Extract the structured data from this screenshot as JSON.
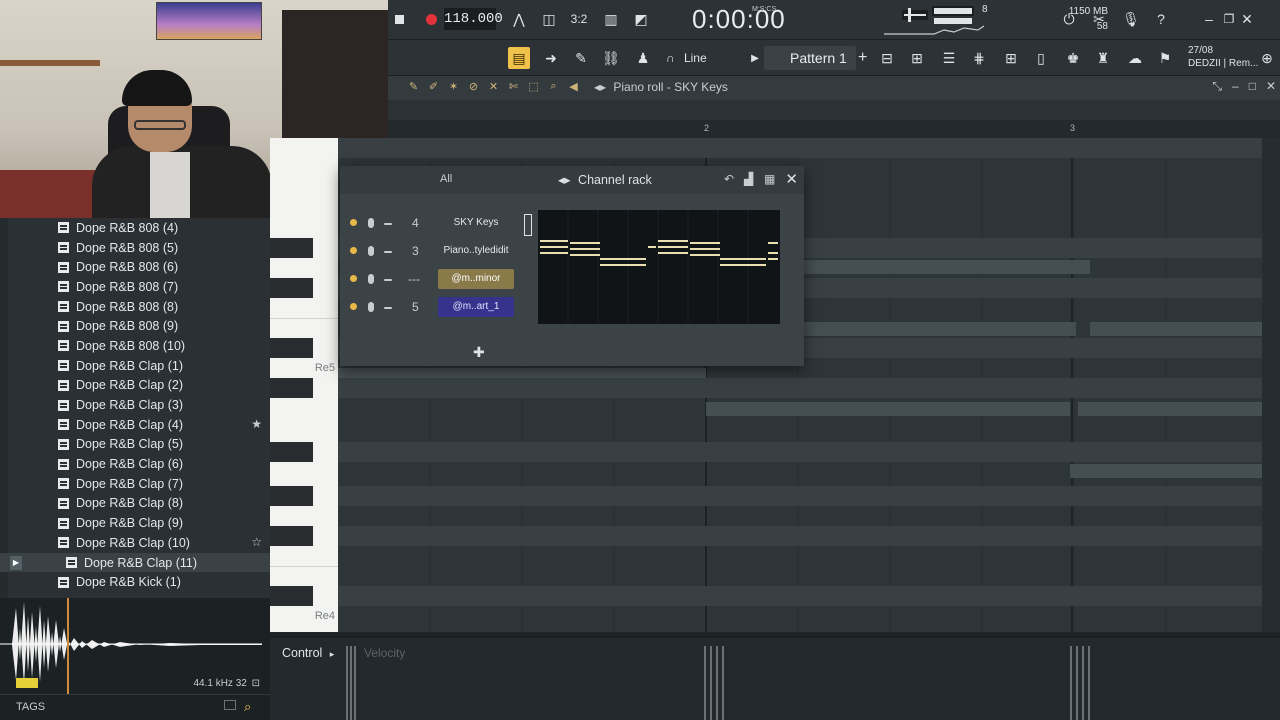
{
  "transport": {
    "tempo": "118.000",
    "time": "0:00:00",
    "time_unit": "M:S:CS",
    "cpu": "8",
    "ram": "1150 MB",
    "polyphony": "58"
  },
  "toolbar": {
    "snap_label": "Line",
    "pattern_label": "Pattern 1",
    "date": "27/08",
    "hint": "DEDZII | Rem..."
  },
  "piano_roll": {
    "title": "Piano roll - SKY Keys",
    "ruler": [
      "2",
      "3"
    ],
    "key_labels": [
      "Re5",
      "Re4"
    ]
  },
  "channel_rack": {
    "title": "Channel rack",
    "filter": "All",
    "channels": [
      {
        "num": "4",
        "name": "SKY Keys",
        "style": "plain"
      },
      {
        "num": "3",
        "name": "Piano..tyledidit",
        "style": "plain"
      },
      {
        "num": "---",
        "name": "@m..minor",
        "style": "gold"
      },
      {
        "num": "5",
        "name": "@m..art_1",
        "style": "blue"
      }
    ]
  },
  "browser": {
    "items": [
      {
        "label": "Dope R&B 808 (4)"
      },
      {
        "label": "Dope R&B 808 (5)"
      },
      {
        "label": "Dope R&B 808 (6)"
      },
      {
        "label": "Dope R&B 808 (7)"
      },
      {
        "label": "Dope R&B 808 (8)"
      },
      {
        "label": "Dope R&B 808 (9)"
      },
      {
        "label": "Dope R&B 808 (10)"
      },
      {
        "label": "Dope R&B Clap (1)"
      },
      {
        "label": "Dope R&B Clap (2)"
      },
      {
        "label": "Dope R&B Clap (3)"
      },
      {
        "label": "Dope R&B Clap (4)",
        "starred": true
      },
      {
        "label": "Dope R&B Clap (5)"
      },
      {
        "label": "Dope R&B Clap (6)"
      },
      {
        "label": "Dope R&B Clap (7)"
      },
      {
        "label": "Dope R&B Clap (8)"
      },
      {
        "label": "Dope R&B Clap (9)"
      },
      {
        "label": "Dope R&B Clap (10)",
        "star_outline": true
      },
      {
        "label": "Dope R&B Clap (11)",
        "selected": true
      },
      {
        "label": "Dope R&B Kick (1)"
      }
    ],
    "sample_info": "44.1 kHz 32",
    "tags_label": "TAGS"
  },
  "control": {
    "label": "Control",
    "lane": "Velocity"
  },
  "colors": {
    "accent": "#f0c24a",
    "record": "#e5323a",
    "note": "#e9dfb3"
  }
}
